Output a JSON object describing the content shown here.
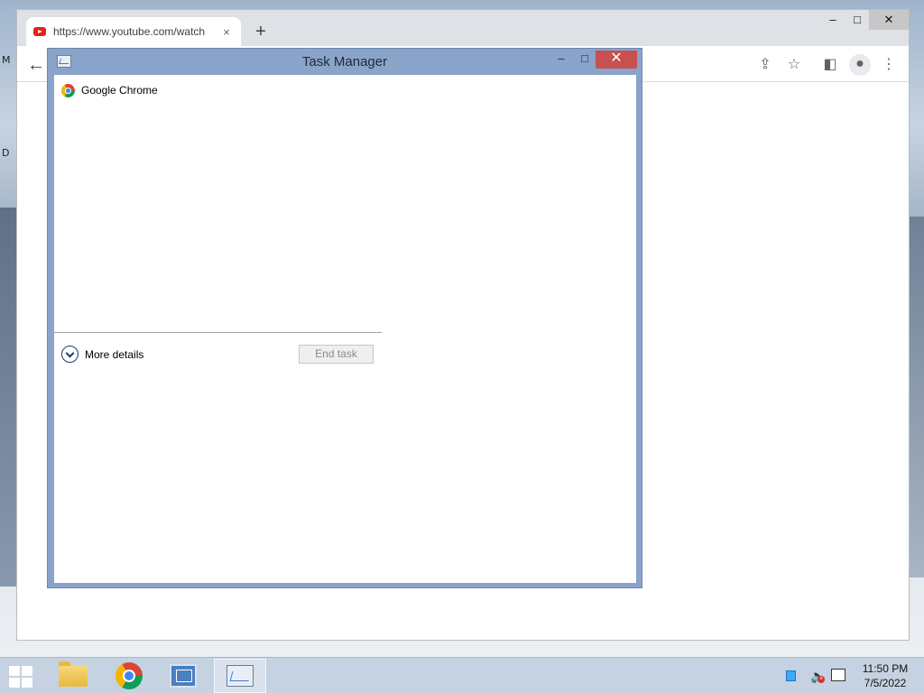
{
  "desktop": {
    "left_text_1": "M",
    "left_text_2": "D"
  },
  "browser": {
    "tab": {
      "title": "https://www.youtube.com/watch",
      "close_glyph": "×",
      "favicon": "youtube-icon"
    },
    "new_tab_glyph": "+",
    "window_controls": {
      "minimize": "–",
      "maximize": "□",
      "close": "✕"
    },
    "toolbar": {
      "back_glyph": "←",
      "share_glyph": "⇪",
      "bookmark_glyph": "☆",
      "sidepanel_glyph": "◧",
      "profile_glyph": "●",
      "menu_glyph": "⋮"
    }
  },
  "task_manager": {
    "title": "Task Manager",
    "minimize_glyph": "–",
    "maximize_glyph": "□",
    "close_glyph": "✕",
    "processes": [
      {
        "name": "Google Chrome",
        "icon": "chrome-icon"
      }
    ],
    "more_details_label": "More details",
    "end_task_label": "End task"
  },
  "taskbar": {
    "pinned": [
      {
        "name": "file-explorer",
        "icon": "folder-icon"
      },
      {
        "name": "google-chrome",
        "icon": "chrome-icon"
      },
      {
        "name": "server-manager",
        "icon": "server-icon"
      },
      {
        "name": "task-manager",
        "icon": "task-manager-icon",
        "active": true
      }
    ],
    "clock": {
      "time": "11:50 PM",
      "date": "7/5/2022"
    }
  },
  "colors": {
    "tm_frame": "#8aa3c9",
    "tm_close": "#c75050",
    "youtube_red": "#e62117"
  }
}
